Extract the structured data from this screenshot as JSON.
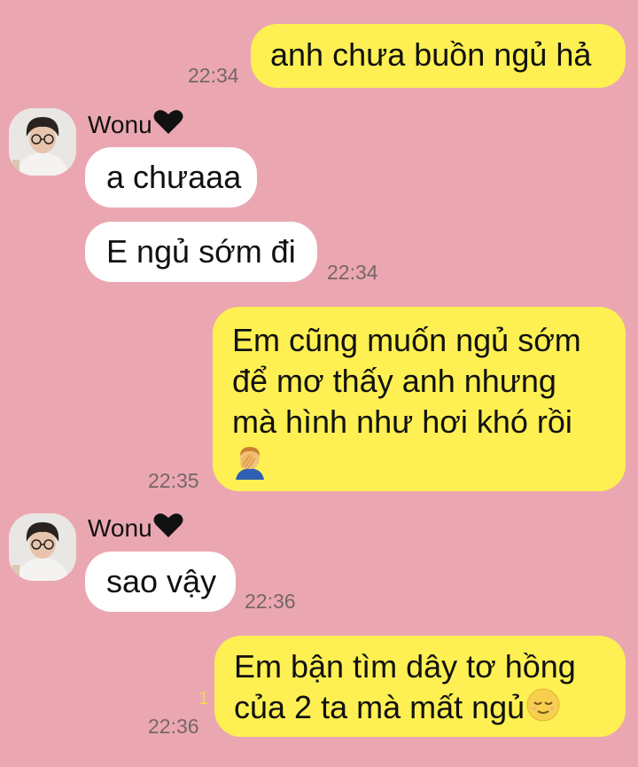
{
  "messages": [
    {
      "side": "me",
      "text": "anh chưa buồn ngủ hả",
      "time": "22:34"
    },
    {
      "side": "them",
      "sender": "Wonu",
      "text": "a chưaaa"
    },
    {
      "side": "them",
      "text": "E ngủ sớm đi",
      "time": "22:34"
    },
    {
      "side": "me",
      "lines": [
        "Em cũng muốn ngủ sớm",
        "để mơ thấy anh nhưng",
        "mà hình như hơi khó rồi"
      ],
      "emoji": "face-palm-emoji",
      "time": "22:35"
    },
    {
      "side": "them",
      "sender": "Wonu",
      "text": "sao vậy",
      "time": "22:36"
    },
    {
      "side": "me",
      "lines": [
        "Em bận tìm dây tơ hồng",
        "của 2 ta mà mất ngủ"
      ],
      "emoji": "relieved-face-emoji",
      "time": "22:36",
      "unread": "1"
    }
  ],
  "colors": {
    "background": "#eba7b1",
    "my_bubble": "#fef052",
    "their_bubble": "#ffffff",
    "timestamp": "#756669",
    "unread_badge": "#f4d84c"
  },
  "icons": {
    "sender_heart": "black-heart-icon"
  }
}
